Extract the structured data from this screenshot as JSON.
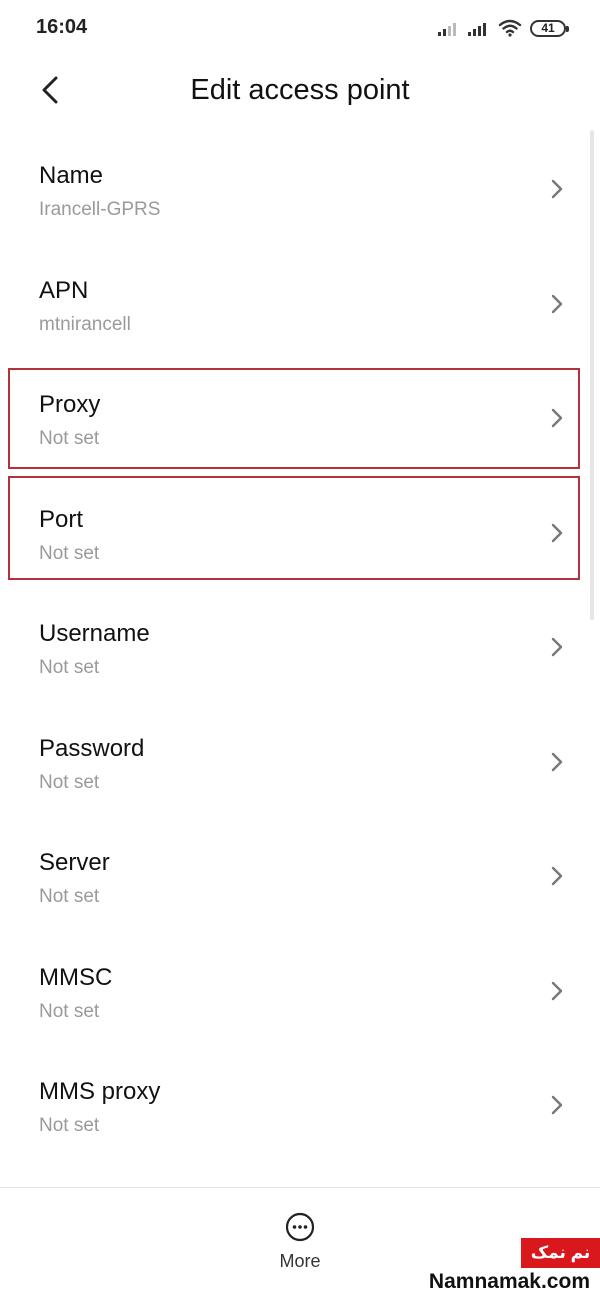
{
  "status_bar": {
    "time": "16:04",
    "battery": "41"
  },
  "header": {
    "title": "Edit access point",
    "back_icon": "chevron-left-icon"
  },
  "items": [
    {
      "label": "Name",
      "value": "Irancell-GPRS",
      "highlighted": false
    },
    {
      "label": "APN",
      "value": "mtnirancell",
      "highlighted": false
    },
    {
      "label": "Proxy",
      "value": "Not set",
      "highlighted": true
    },
    {
      "label": "Port",
      "value": "Not set",
      "highlighted": true
    },
    {
      "label": "Username",
      "value": "Not set",
      "highlighted": false
    },
    {
      "label": "Password",
      "value": "Not set",
      "highlighted": false
    },
    {
      "label": "Server",
      "value": "Not set",
      "highlighted": false
    },
    {
      "label": "MMSC",
      "value": "Not set",
      "highlighted": false
    },
    {
      "label": "MMS proxy",
      "value": "Not set",
      "highlighted": false
    }
  ],
  "bottom_bar": {
    "more_label": "More",
    "more_icon": "more-horizontal-icon"
  },
  "watermark": {
    "badge": "نم نمک",
    "site": "Namnamak.com"
  },
  "colors": {
    "highlight_border": "#b5323c",
    "secondary_text": "#9a9a9a",
    "watermark_red": "#d9181e"
  }
}
